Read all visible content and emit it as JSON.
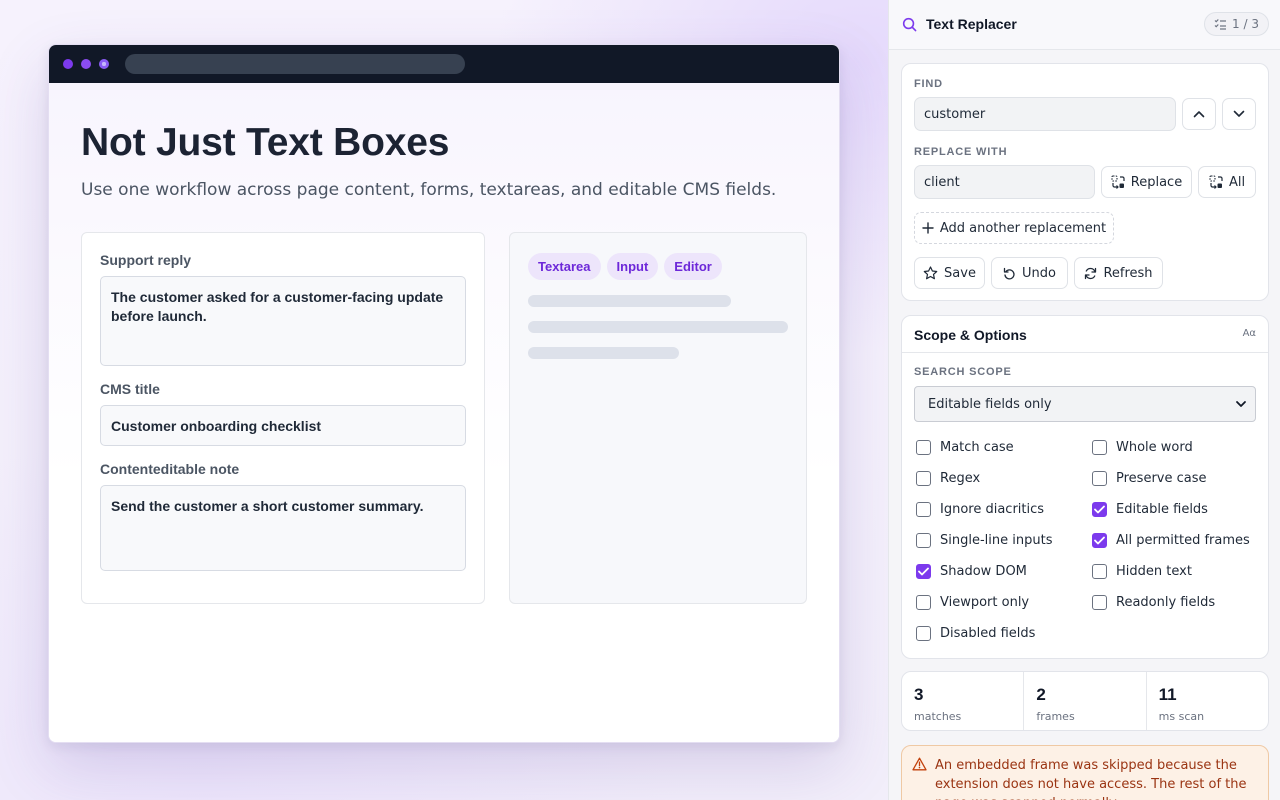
{
  "page": {
    "title": "Not Just Text Boxes",
    "subtitle": "Use one workflow across page content, forms, textareas, and editable CMS fields."
  },
  "demo": {
    "fields": [
      {
        "label": "Support reply",
        "value": "The customer asked for a customer-facing update before launch."
      },
      {
        "label": "CMS title",
        "value": "Customer onboarding checklist"
      },
      {
        "label": "Contenteditable note",
        "value": "Send the customer a short customer summary."
      }
    ],
    "chips": [
      "Textarea",
      "Input",
      "Editor"
    ]
  },
  "panel": {
    "title": "Text Replacer",
    "counter": "1 / 3",
    "find_label": "FIND",
    "find_value": "customer",
    "replace_label": "REPLACE WITH",
    "replace_value": "client",
    "replace_button": "Replace",
    "all_button": "All",
    "add_replacement": "Add another replacement",
    "save_button": "Save",
    "undo_button": "Undo",
    "refresh_button": "Refresh",
    "scope_title": "Scope & Options",
    "scope_aa": "Aα",
    "search_scope_label": "SEARCH SCOPE",
    "search_scope_value": "Editable fields only",
    "options": [
      {
        "label": "Match case",
        "checked": false
      },
      {
        "label": "Whole word",
        "checked": false
      },
      {
        "label": "Regex",
        "checked": false
      },
      {
        "label": "Preserve case",
        "checked": false
      },
      {
        "label": "Ignore diacritics",
        "checked": false
      },
      {
        "label": "Editable fields",
        "checked": true
      },
      {
        "label": "Single-line inputs",
        "checked": false
      },
      {
        "label": "All permitted frames",
        "checked": true
      },
      {
        "label": "Shadow DOM",
        "checked": true
      },
      {
        "label": "Hidden text",
        "checked": false
      },
      {
        "label": "Viewport only",
        "checked": false
      },
      {
        "label": "Readonly fields",
        "checked": false
      },
      {
        "label": "Disabled fields",
        "checked": false
      }
    ],
    "stats": [
      {
        "value": "3",
        "label": "matches"
      },
      {
        "value": "2",
        "label": "frames"
      },
      {
        "value": "11",
        "label": "ms scan"
      }
    ],
    "warning": "An embedded frame was skipped because the extension does not have access. The rest of the page was scanned normally."
  },
  "colors": {
    "accent": "#7c3aed",
    "chip_bg": "#ede5fb",
    "warning_bg": "#fdf1e6",
    "warning_text": "#9a3412",
    "browser_bar": "#111827"
  }
}
